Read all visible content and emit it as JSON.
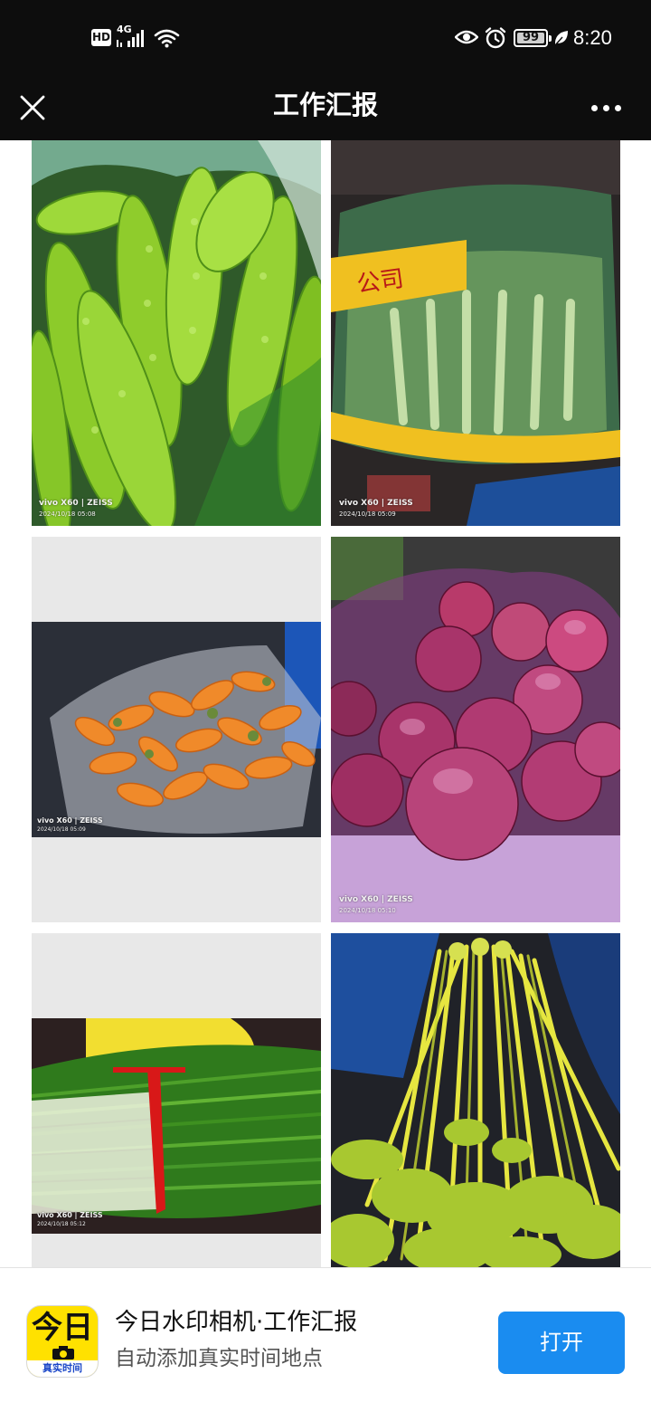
{
  "status_bar": {
    "hd_badge": "HD",
    "network": "4G",
    "battery": "99",
    "battery_level": 0.99,
    "time": "8:20"
  },
  "title_bar": {
    "title": "工作汇报",
    "close_icon": "close-icon",
    "more_icon": "more-icon"
  },
  "gallery": {
    "photos": [
      {
        "subject": "bitter-melon",
        "camera": "vivo X60 | ZEISS",
        "timestamp": "2024/10/18 05:08"
      },
      {
        "subject": "packaged-celery",
        "camera": "vivo X60 | ZEISS",
        "timestamp": "2024/10/18 05:09",
        "bag_text": "公司"
      },
      {
        "subject": "carrots",
        "camera": "vivo X60 | ZEISS",
        "timestamp": "2024/10/18 05:09"
      },
      {
        "subject": "red-onions",
        "camera": "vivo X60 | ZEISS",
        "timestamp": "2024/10/18 05:10"
      },
      {
        "subject": "green-onions",
        "camera": "vivo X60 | ZEISS",
        "timestamp": "2024/10/18 05:12"
      },
      {
        "subject": "celery-bunch"
      }
    ]
  },
  "banner": {
    "app_icon_text_top": "今日",
    "app_icon_text_bottom": "真实时间",
    "title": "今日水印相机·工作汇报",
    "subtitle": "自动添加真实时间地点",
    "open_button": "打开",
    "accent": "#1a8cf0",
    "icon_color": "#ffe100"
  }
}
